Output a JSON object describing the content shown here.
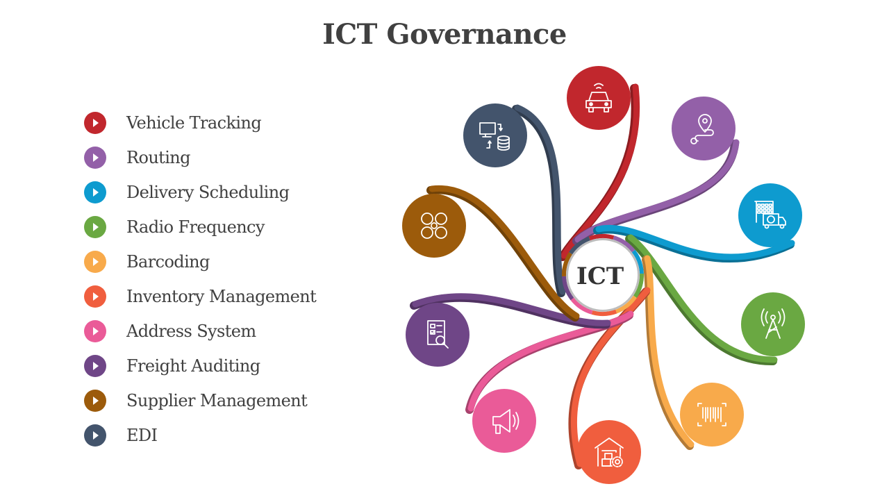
{
  "title": "ICT Governance",
  "center_label": "ICT",
  "items": [
    {
      "label": "Vehicle Tracking",
      "color": "#C1272D",
      "icon": "connected-car-icon"
    },
    {
      "label": "Routing",
      "color": "#9360A8",
      "icon": "route-pin-icon"
    },
    {
      "label": "Delivery Scheduling",
      "color": "#0E9BCF",
      "icon": "building-delivery-truck-icon"
    },
    {
      "label": "Radio Frequency",
      "color": "#6AA842",
      "icon": "radio-tower-icon"
    },
    {
      "label": "Barcoding",
      "color": "#F8AA4B",
      "icon": "barcode-scan-icon"
    },
    {
      "label": "Inventory Management",
      "color": "#F05E3E",
      "icon": "warehouse-gear-icon"
    },
    {
      "label": "Address System",
      "color": "#EA5B98",
      "icon": "megaphone-icon"
    },
    {
      "label": "Freight Auditing",
      "color": "#6F4687",
      "icon": "audit-checklist-icon"
    },
    {
      "label": "Supplier Management",
      "color": "#9C5B0B",
      "icon": "supplier-network-icon"
    },
    {
      "label": "EDI",
      "color": "#43546C",
      "icon": "computer-database-sync-icon"
    }
  ]
}
